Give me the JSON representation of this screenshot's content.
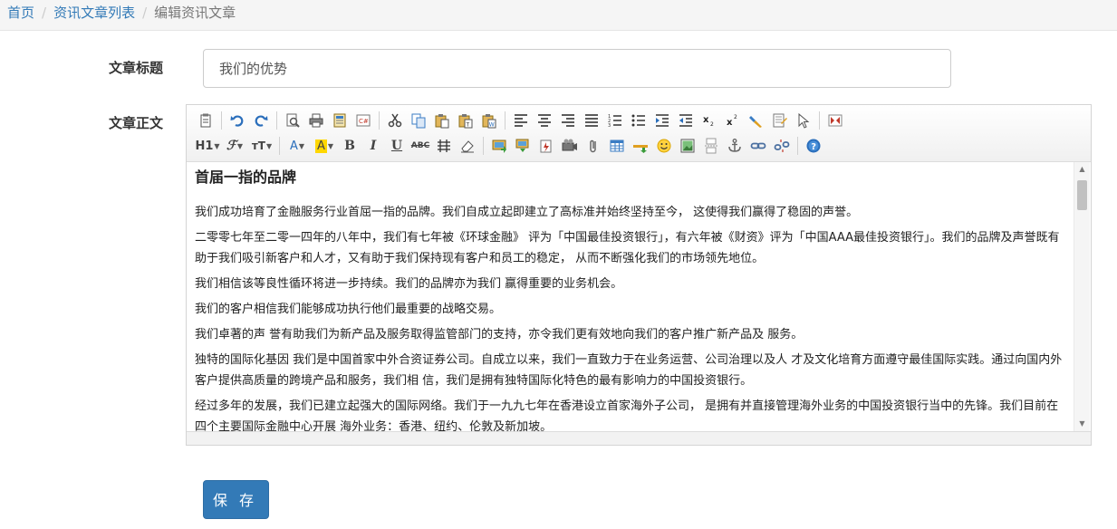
{
  "breadcrumb": {
    "items": [
      "首页",
      "资讯文章列表"
    ],
    "current": "编辑资讯文章"
  },
  "form": {
    "title_label": "文章标题",
    "title_value": "我们的优势",
    "body_label": "文章正文",
    "save_label": "保 存"
  },
  "toolbar": {
    "heading_label": "H1",
    "row1_icons": [
      "source-icon",
      "undo-icon",
      "redo-icon",
      "preview-icon",
      "print-icon",
      "template-icon",
      "code-icon",
      "cut-icon",
      "copy-icon",
      "paste-icon",
      "paste-text-icon",
      "paste-word-icon",
      "align-left-icon",
      "align-center-icon",
      "align-right-icon",
      "align-justify-icon",
      "ordered-list-icon",
      "unordered-list-icon",
      "indent-icon",
      "outdent-icon",
      "subscript-icon",
      "superscript-icon",
      "clear-format-icon",
      "select-all-icon",
      "anchor-select-icon",
      "fullscreen-icon"
    ],
    "row2_icons": [
      "heading-icon",
      "font-family-icon",
      "font-size-icon",
      "font-color-icon",
      "highlight-icon",
      "bold-icon",
      "italic-icon",
      "underline-icon",
      "strikethrough-icon",
      "line-height-icon",
      "eraser-icon",
      "image-upload-icon",
      "multi-image-icon",
      "flash-icon",
      "media-icon",
      "attachment-icon",
      "table-icon",
      "hr-icon",
      "emoticon-icon",
      "image-icon",
      "page-break-icon",
      "anchor-icon",
      "link-icon",
      "unlink-icon",
      "help-icon"
    ]
  },
  "article": {
    "heading": "首届一指的品牌",
    "paragraphs": [
      "我们成功培育了金融服务行业首屈一指的品牌。我们自成立起即建立了高标准并始终坚持至今， 这使得我们赢得了稳固的声誉。",
      "二零零七年至二零一四年的八年中，我们有七年被《环球金融》 评为「中国最佳投资银行」，有六年被《财资》评为「中国AAA最佳投资银行」。我们的品牌及声誉既有助于我们吸引新客户和人才，又有助于我们保持现有客户和员工的稳定， 从而不断强化我们的市场领先地位。",
      "我们相信该等良性循环将进一步持续。我们的品牌亦为我们 赢得重要的业务机会。",
      "我们的客户相信我们能够成功执行他们最重要的战略交易。",
      "我们卓著的声 誉有助我们为新产品及服务取得监管部门的支持，亦令我们更有效地向我们的客户推广新产品及 服务。",
      "独特的国际化基因 我们是中国首家中外合资证券公司。自成立以来，我们一直致力于在业务运营、公司治理以及人 才及文化培育方面遵守最佳国际实践。通过向国内外客户提供高质量的跨境产品和服务，我们相 信，我们是拥有独特国际化特色的最有影响力的中国投资银行。",
      "经过多年的发展，我们已建立起强大的国际网络。我们于一九九七年在香港设立首家海外子公司， 是拥有并直接管理海外业务的中国投资银行当中的先锋。我们目前在四个主要国际金融中心开展 海外业务：香港、纽约、伦敦及新加坡。"
    ]
  }
}
